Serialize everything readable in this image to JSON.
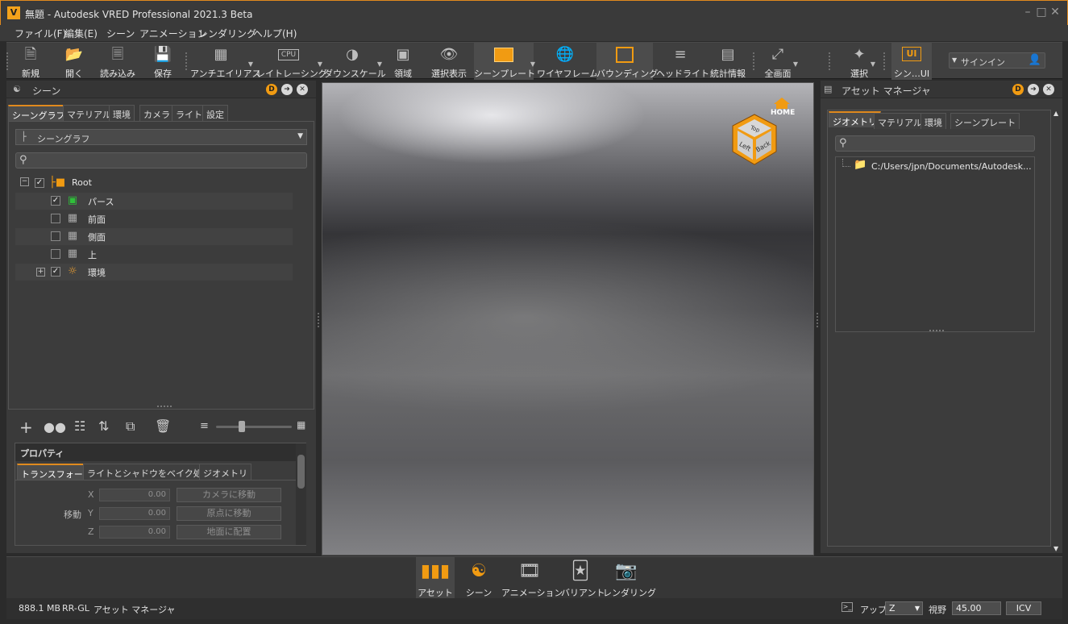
{
  "window": {
    "title": "無題 - Autodesk VRED Professional 2021.3 Beta",
    "app_icon_letter": "V",
    "accent_color": "#e08a1e"
  },
  "menu": [
    "ファイル(F)",
    "編集(E)",
    "シーン",
    "アニメーション",
    "レンダリング",
    "ヘルプ(H)"
  ],
  "toolbar": {
    "new": "新規",
    "open": "開く",
    "import": "読み込み",
    "save": "保存",
    "antialias": "アンチエイリアス",
    "raytracing": "レイトレーシング",
    "downscale": "ダウンスケール",
    "region": "領域",
    "selection_display": "選択表示",
    "sceneplate": "シーンプレート",
    "wireframe": "ワイヤフレーム",
    "bounding": "バウンディング",
    "headlight": "ヘッドライト",
    "statistics": "統計情報",
    "fullscreen": "全画面",
    "select": "選択",
    "scene_ui": "シン…UI",
    "signin": "サインイン",
    "cpu_badge": "CPU",
    "ui_badge": "UI"
  },
  "scene_panel": {
    "title": "シーン",
    "tabs": [
      "シーングラフ",
      "マテリアル",
      "環境",
      "カメラ",
      "ライト",
      "設定"
    ],
    "combo_value": "シーングラフ",
    "search_placeholder": "",
    "tree": [
      {
        "label": "Root",
        "checked": true,
        "expander": "minus",
        "icon": "root-node-icon"
      },
      {
        "label": "パース",
        "checked": true,
        "icon": "perspective-camera-icon"
      },
      {
        "label": "前面",
        "checked": false,
        "icon": "front-camera-icon"
      },
      {
        "label": "側面",
        "checked": false,
        "icon": "side-camera-icon"
      },
      {
        "label": "上",
        "checked": false,
        "icon": "top-camera-icon"
      },
      {
        "label": "環境",
        "checked": true,
        "expander": "plus",
        "icon": "environment-icon"
      }
    ]
  },
  "properties": {
    "title": "プロパティ",
    "tabs": [
      "トランスフォーム",
      "ライトとシャドウをベイク処理",
      "ジオメトリ"
    ],
    "move_label": "移動",
    "axes": [
      "X",
      "Y",
      "Z"
    ],
    "values": [
      "0.00",
      "0.00",
      "0.00"
    ],
    "buttons": [
      "カメラに移動",
      "原点に移動",
      "地面に配置"
    ]
  },
  "asset_panel": {
    "title": "アセット マネージャ",
    "tabs": [
      "ジオメトリ",
      "マテリアル",
      "環境",
      "シーンプレート"
    ],
    "path": "C:/Users/jpn/Documents/Autodesk..."
  },
  "navcube": {
    "home_label": "HOME",
    "faces": [
      "Top",
      "Left",
      "Back"
    ]
  },
  "bottom_modules": [
    "アセット",
    "シーン",
    "アニメーション",
    "バリアント",
    "レンダリング"
  ],
  "status": {
    "memory": "888.1 MB",
    "renderer": "RR-GL",
    "context": "アセット マネージャ",
    "up_label": "アップ",
    "up_value": "Z",
    "fov_label": "視野",
    "fov_value": "45.00",
    "icv": "ICV"
  }
}
